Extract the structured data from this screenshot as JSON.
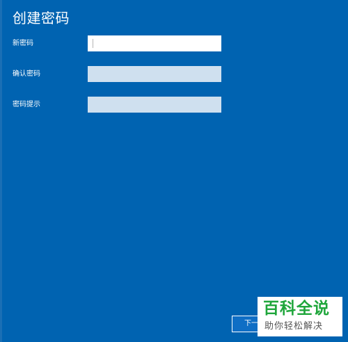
{
  "page": {
    "title": "创建密码"
  },
  "form": {
    "new_password_label": "新密码",
    "new_password_value": "",
    "confirm_password_label": "确认密码",
    "confirm_password_value": "",
    "hint_label": "密码提示",
    "hint_value": ""
  },
  "footer": {
    "next_label": "下一步"
  },
  "watermark": {
    "title": "百科全说",
    "subtitle": "助你轻松解决"
  },
  "colors": {
    "background": "#0063b1",
    "input_active": "#ffffff",
    "input_inactive": "#cfe0ef",
    "watermark_green": "#1fa63b"
  }
}
